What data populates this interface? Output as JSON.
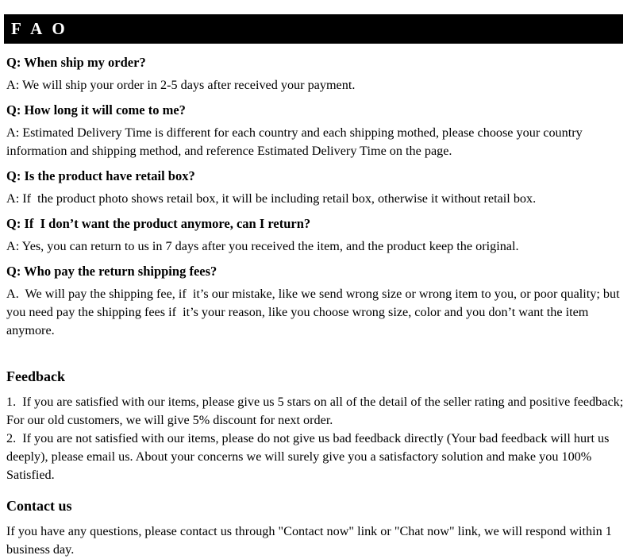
{
  "banner": {
    "title": "F A O"
  },
  "faq": {
    "items": [
      {
        "question": "Q: When ship my order?",
        "answer": "A: We will ship your order in 2-5 days after received your payment."
      },
      {
        "question": "Q: How long it will come to me?",
        "answer": "A: Estimated Delivery Time is different for each country and each shipping mothed, please choose your country information and shipping method, and reference Estimated Delivery Time on the page."
      },
      {
        "question": "Q: Is the product have retail box?",
        "answer": "A: If  the product photo shows retail box, it will be including retail box, otherwise it without retail box."
      },
      {
        "question": "Q: If  I don’t want the product anymore, can I return?",
        "answer": "A: Yes, you can return to us in 7 days after you received the item, and the product keep the original."
      },
      {
        "question": "Q: Who pay the return shipping fees?",
        "answer": "A.  We will pay the shipping fee, if  it’s our mistake, like we send wrong size or wrong item to you, or poor quality; but you need pay the shipping fees if  it’s your reason, like you choose wrong size, color and you don’t want the item anymore."
      }
    ]
  },
  "feedback": {
    "heading": "Feedback",
    "item1": "1.  If you are satisfied with our items, please give us 5 stars on all of the detail of the seller rating and positive feedback; For our old customers, we will give 5% discount for next order.",
    "item2": "2.  If you are not satisfied with our items, please do not give us bad feedback directly (Your bad feedback will hurt us deeply), please email us. About your concerns we will surely give you a satisfactory solution and make you 100% Satisfied."
  },
  "contact": {
    "heading": "Contact us",
    "text": "If you have any questions, please contact us through \"Contact now\" link or \"Chat now\" link, we will respond within 1 business day."
  },
  "colors": {
    "banner_background": "#000000",
    "banner_text": "#ffffff",
    "page_background": "#ffffff",
    "body_text": "#000000"
  }
}
